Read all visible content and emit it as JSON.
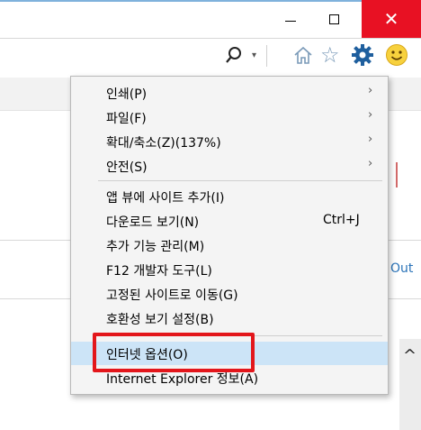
{
  "window": {
    "close_symbol": "✕"
  },
  "toolbar": {
    "search_icon": "search-icon",
    "dropdown_symbol": "▾",
    "star_symbol": "☆"
  },
  "page": {
    "out_text": "Out"
  },
  "menu": {
    "items": [
      {
        "label": "인쇄(P)",
        "arrow": "›"
      },
      {
        "label": "파일(F)",
        "arrow": "›"
      },
      {
        "label": "확대/축소(Z)(137%)",
        "arrow": "›"
      },
      {
        "label": "안전(S)",
        "arrow": "›"
      },
      {
        "label": "앱 뷰에 사이트 추가(I)"
      },
      {
        "label": "다운로드 보기(N)",
        "shortcut": "Ctrl+J"
      },
      {
        "label": "추가 기능 관리(M)"
      },
      {
        "label": "F12 개발자 도구(L)"
      },
      {
        "label": "고정된 사이트로 이동(G)"
      },
      {
        "label": "호환성 보기 설정(B)"
      },
      {
        "label": "인터넷 옵션(O)"
      },
      {
        "label": "Internet Explorer 정보(A)"
      }
    ]
  },
  "scroll": {
    "up_symbol": "^"
  },
  "colors": {
    "close_red": "#e81123",
    "highlight": "#cce4f7",
    "annotation_red": "#e3161b"
  }
}
